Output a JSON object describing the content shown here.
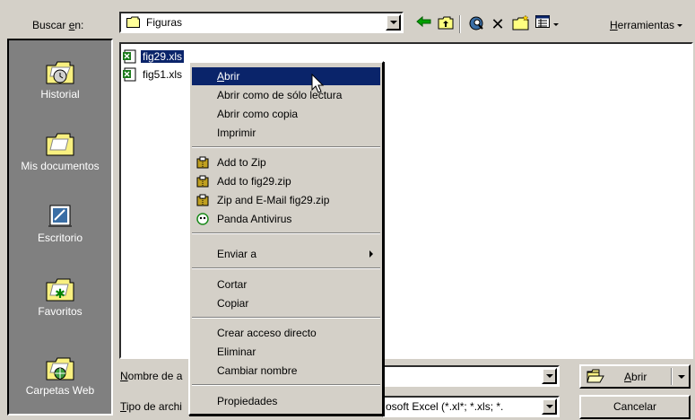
{
  "toolbar": {
    "look_in_label_prefix": "Buscar ",
    "look_in_label_accel": "e",
    "look_in_label_suffix": "n:",
    "look_in_value": "Figuras",
    "back_icon": "back-arrow-icon",
    "up_icon": "up-folder-icon",
    "search_web_icon": "search-web-icon",
    "delete_icon": "delete-x-icon",
    "new_folder_icon": "new-folder-icon",
    "views_icon": "views-icon",
    "tools_label_accel": "H",
    "tools_label_rest": "erramientas"
  },
  "places": [
    {
      "label": "Historial",
      "icon": "history-icon"
    },
    {
      "label": "Mis documentos",
      "icon": "my-documents-icon"
    },
    {
      "label": "Escritorio",
      "icon": "desktop-icon"
    },
    {
      "label": "Favoritos",
      "icon": "favorites-icon"
    },
    {
      "label": "Carpetas Web",
      "icon": "web-folders-icon"
    }
  ],
  "files": [
    {
      "name": "fig29.xls",
      "selected": true
    },
    {
      "name": "fig51.xls",
      "selected": false
    }
  ],
  "bottom": {
    "filename_label_accel": "N",
    "filename_label_rest": "ombre de a",
    "filetype_label_accel": "T",
    "filetype_label_rest": "ipo de archi",
    "filetype_value": "osoft Excel (*.xl*; *.xls; *.",
    "open_button_accel": "A",
    "open_button_rest": "brir",
    "cancel_button": "Cancelar"
  },
  "context_menu": {
    "items": [
      {
        "accel": "A",
        "rest": "brir",
        "highlighted": true
      },
      {
        "text": "Abrir como de sólo lectura"
      },
      {
        "text": "Abrir como copia"
      },
      {
        "text": "Imprimir"
      },
      {
        "text": "Add to Zip",
        "icon": "zip-icon"
      },
      {
        "text": "Add to fig29.zip",
        "icon": "zip-icon"
      },
      {
        "text": "Zip and E-Mail fig29.zip",
        "icon": "zip-icon"
      },
      {
        "text": "Panda Antivirus",
        "icon": "panda-antivirus-icon"
      },
      {
        "text": "Enviar a",
        "submenu": true
      },
      {
        "text": "Cortar"
      },
      {
        "text": "Copiar"
      },
      {
        "text": "Crear acceso directo"
      },
      {
        "text": "Eliminar"
      },
      {
        "text": "Cambiar nombre"
      },
      {
        "text": "Propiedades"
      }
    ]
  }
}
